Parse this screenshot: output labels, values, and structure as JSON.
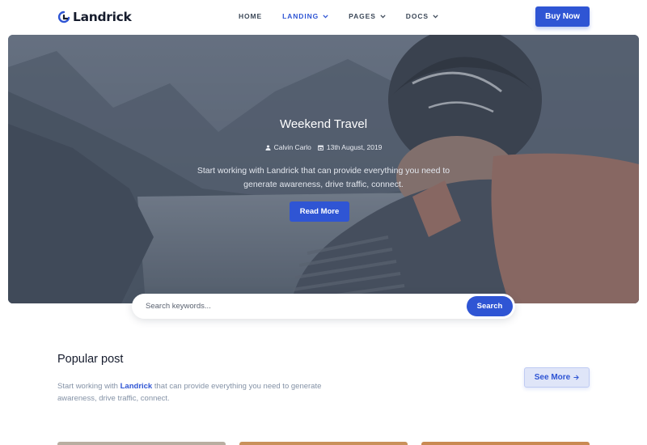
{
  "brand": {
    "name": "Landrick"
  },
  "nav": {
    "items": [
      {
        "label": "HOME",
        "has_dropdown": false,
        "active": false
      },
      {
        "label": "LANDING",
        "has_dropdown": true,
        "active": true
      },
      {
        "label": "PAGES",
        "has_dropdown": true,
        "active": false
      },
      {
        "label": "DOCS",
        "has_dropdown": true,
        "active": false
      }
    ],
    "cta_label": "Buy Now"
  },
  "hero": {
    "title": "Weekend Travel",
    "author": "Calvin Carlo",
    "date": "13th August, 2019",
    "desc_line1": "Start working with Landrick that can provide everything you need to",
    "desc_line2": "generate awareness, drive traffic, connect.",
    "button_label": "Read More"
  },
  "search": {
    "placeholder": "Search keywords...",
    "value": "",
    "button_label": "Search"
  },
  "popular": {
    "title": "Popular post",
    "desc_prefix": "Start working with ",
    "desc_brand": "Landrick",
    "desc_suffix": " that can provide everything you need to generate awareness, drive traffic, connect.",
    "see_more_label": "See More"
  },
  "colors": {
    "primary": "#2f55d4",
    "heading": "#161c2d",
    "muted": "#8492a6"
  }
}
